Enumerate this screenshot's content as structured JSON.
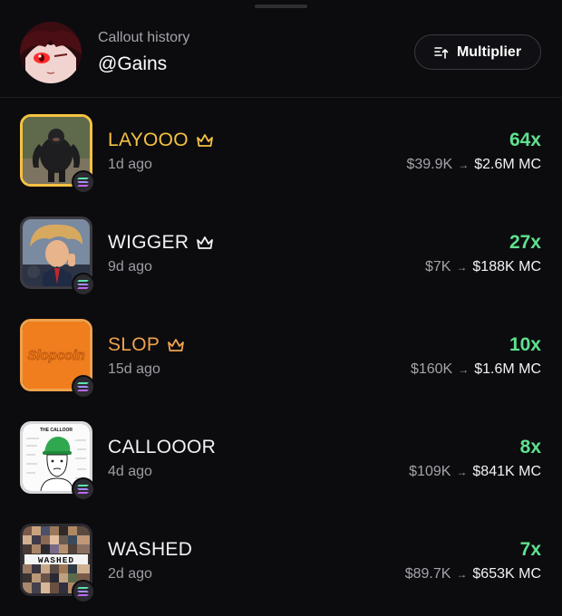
{
  "header": {
    "subtitle": "Callout history",
    "handle": "@Gains",
    "multiplier_button": "Multiplier"
  },
  "colors": {
    "gold": "#f5c242",
    "orange": "#f0a24d",
    "white": "#f2f2f4",
    "green": "#5ee08e",
    "muted": "#a3a3aa"
  },
  "callouts": [
    {
      "name": "LAYOOO",
      "age": "1d ago",
      "multiplier": "64x",
      "from": "$39.9K",
      "to": "$2.6M MC",
      "crown": true,
      "name_color": "gold",
      "thumb_icon": "gorilla-image"
    },
    {
      "name": "WIGGER",
      "age": "9d ago",
      "multiplier": "27x",
      "from": "$7K",
      "to": "$188K MC",
      "crown": true,
      "name_color": "white",
      "thumb_icon": "windblown-hair-man-image"
    },
    {
      "name": "SLOP",
      "age": "15d ago",
      "multiplier": "10x",
      "from": "$160K",
      "to": "$1.6M MC",
      "crown": true,
      "name_color": "orange",
      "thumb_icon": "slopcoin-logo",
      "thumb_text": "Slopcoin"
    },
    {
      "name": "CALLOOOR",
      "age": "4d ago",
      "multiplier": "8x",
      "from": "$109K",
      "to": "$841K MC",
      "crown": false,
      "name_color": "white",
      "thumb_icon": "wojak-caller-meme",
      "thumb_text": "THE CALLOOR"
    },
    {
      "name": "WASHED",
      "age": "2d ago",
      "multiplier": "7x",
      "from": "$89.7K",
      "to": "$653K MC",
      "crown": false,
      "name_color": "white",
      "thumb_icon": "washed-collage",
      "thumb_text": "WASHED"
    }
  ]
}
